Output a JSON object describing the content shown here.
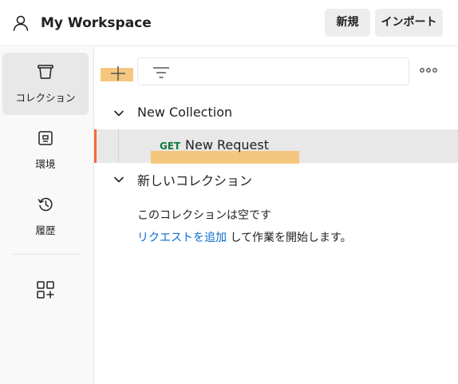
{
  "header": {
    "workspace_icon": "user-icon",
    "workspace_title": "My Workspace",
    "new_button": "新規",
    "import_button": "インポート"
  },
  "sidebar": {
    "items": [
      {
        "label": "コレクション",
        "icon": "collections-icon",
        "active": true
      },
      {
        "label": "環境",
        "icon": "environments-icon",
        "active": false
      },
      {
        "label": "履歴",
        "icon": "history-icon",
        "active": false
      }
    ],
    "apps_icon": "add-apps-icon"
  },
  "toolbar": {
    "add_icon": "plus-icon",
    "filter_icon": "filter-icon",
    "more_icon": "more-options-icon"
  },
  "collections": [
    {
      "name": "New Collection",
      "expanded": true,
      "requests": [
        {
          "method": "GET",
          "name": "New Request",
          "selected": true
        }
      ]
    },
    {
      "name": "新しいコレクション",
      "expanded": true,
      "empty_message": "このコレクションは空です",
      "empty_link": "リクエストを追加",
      "empty_suffix": " して作業を開始します。"
    }
  ],
  "colors": {
    "accent": "#f26b3a",
    "get_method": "#0e7a3b",
    "link": "#0b6bcb",
    "highlight": "#f5c77e"
  }
}
